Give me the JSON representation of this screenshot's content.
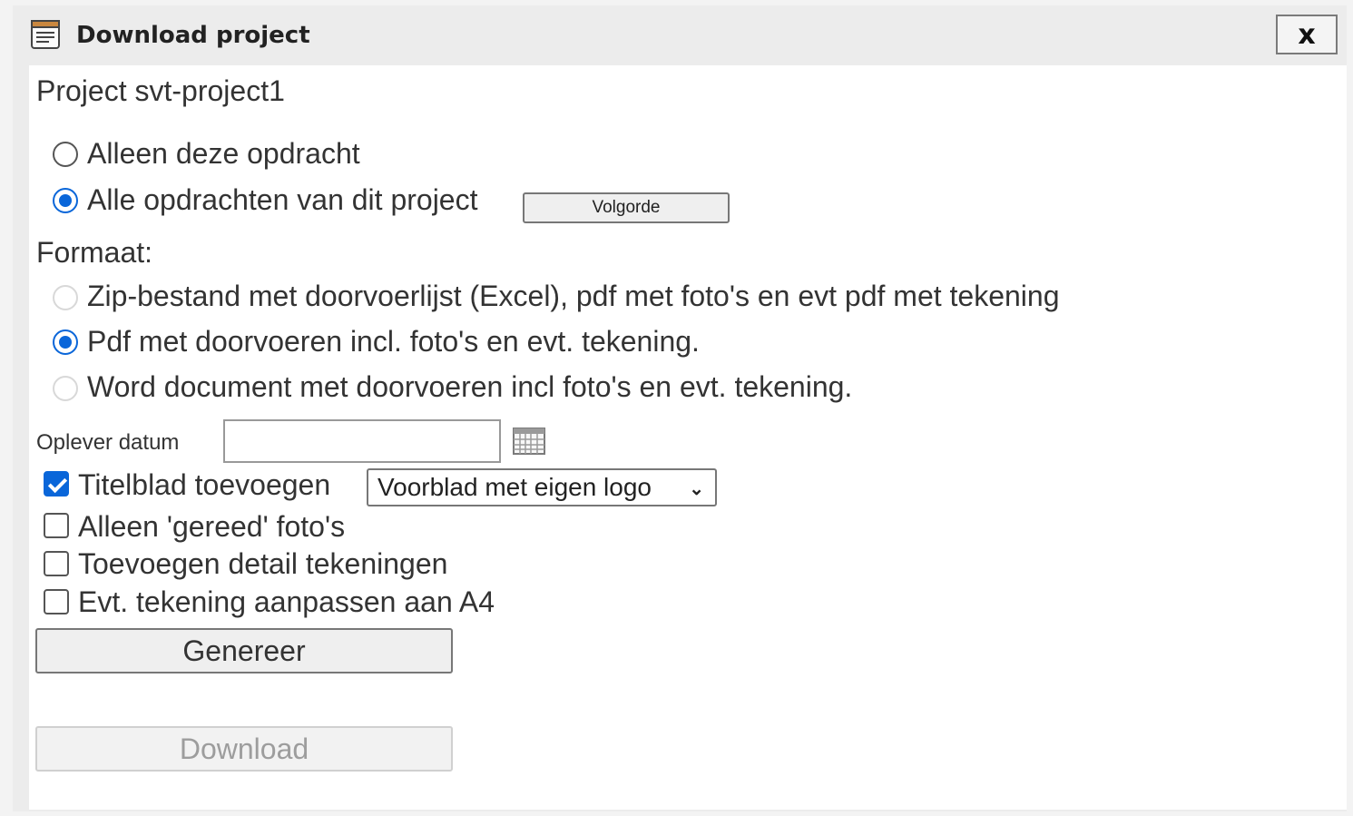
{
  "window": {
    "title": "Download project",
    "close_label": "x"
  },
  "project_heading": "Project svt-project1",
  "scope": {
    "options": [
      {
        "label": "Alleen deze opdracht",
        "checked": false
      },
      {
        "label": "Alle opdrachten van dit project",
        "checked": true
      }
    ],
    "order_button_label": "Volgorde"
  },
  "format": {
    "label": "Formaat:",
    "options": [
      {
        "label": "Zip-bestand met doorvoerlijst (Excel), pdf met foto's en evt pdf met tekening",
        "checked": false,
        "disabled": true
      },
      {
        "label": "Pdf met doorvoeren incl. foto's en evt. tekening.",
        "checked": true,
        "disabled": false
      },
      {
        "label": "Word document met doorvoeren incl foto's en evt. tekening.",
        "checked": false,
        "disabled": true
      }
    ]
  },
  "delivery_date": {
    "label": "Oplever datum",
    "value": "",
    "icon": "calendar-icon"
  },
  "options": {
    "title_page": {
      "label": "Titelblad toevoegen",
      "checked": true,
      "select_value": "Voorblad met eigen logo"
    },
    "only_done_photos": {
      "label": "Alleen 'gereed' foto's",
      "checked": false
    },
    "add_detail_drawings": {
      "label": "Toevoegen detail tekeningen",
      "checked": false
    },
    "fit_drawing_a4": {
      "label": "Evt. tekening aanpassen aan A4",
      "checked": false
    }
  },
  "actions": {
    "generate_label": "Genereer",
    "download_label": "Download",
    "download_disabled": true
  },
  "colors": {
    "accent": "#0a66d9",
    "disabled_text": "#9d9d9d"
  }
}
